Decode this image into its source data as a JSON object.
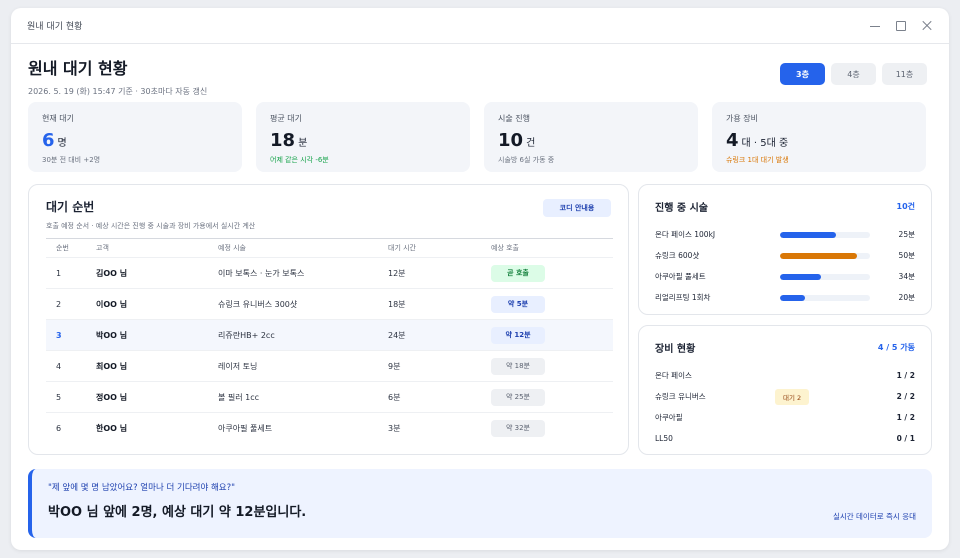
{
  "window": {
    "title": "원내 대기 현황"
  },
  "header": {
    "title": "원내 대기 현황",
    "subtitle": "2026. 5. 19 (화) 15:47 기준 · 30초마다 자동 갱신"
  },
  "floors": [
    {
      "label": "3층",
      "active": true
    },
    {
      "label": "4층",
      "active": false
    },
    {
      "label": "11층",
      "active": false
    }
  ],
  "stats": [
    {
      "label": "현재 대기",
      "value": "6",
      "unit": "명",
      "note": "30분 전 대비 +2명",
      "accent": "blue",
      "note_color": "gray"
    },
    {
      "label": "평균 대기",
      "value": "18",
      "unit": "분",
      "note": "어제 같은 시각 -6분",
      "accent": "dark",
      "note_color": "green"
    },
    {
      "label": "시술 진행",
      "value": "10",
      "unit": "건",
      "note": "시술방 6실 가동 중",
      "accent": "dark",
      "note_color": "gray"
    },
    {
      "label": "가용 장비",
      "value": "4",
      "unit": "대 · 5대 중",
      "note": "슈링크 1대 대기 발생",
      "accent": "dark",
      "note_color": "orange"
    }
  ],
  "queue": {
    "title": "대기 순번",
    "description": "호출 예정 순서 · 예상 시간은 진행 중 시술과 장비 가용에서 실시간 계산",
    "coord_button": "코디 안내용",
    "columns": [
      "순번",
      "고객",
      "예정 시술",
      "대기 시간",
      "예상 호출"
    ],
    "rows": [
      {
        "no": "1",
        "name": "김OO 님",
        "procedure": "이마 보톡스 · 눈가 보톡스",
        "wait": "12분",
        "call": "곧 호출",
        "style": "green",
        "highlight": false
      },
      {
        "no": "2",
        "name": "이OO 님",
        "procedure": "슈링크 유니버스 300샷",
        "wait": "18분",
        "call": "약 5분",
        "style": "blue",
        "highlight": false
      },
      {
        "no": "3",
        "name": "박OO 님",
        "procedure": "리쥬란HB+ 2cc",
        "wait": "24분",
        "call": "약 12분",
        "style": "blue",
        "highlight": true
      },
      {
        "no": "4",
        "name": "최OO 님",
        "procedure": "레이저 토닝",
        "wait": "9분",
        "call": "약 18분",
        "style": "gray",
        "highlight": false
      },
      {
        "no": "5",
        "name": "정OO 님",
        "procedure": "볼 필러 1cc",
        "wait": "6분",
        "call": "약 25분",
        "style": "gray",
        "highlight": false
      },
      {
        "no": "6",
        "name": "한OO 님",
        "procedure": "아쿠아필 풀세트",
        "wait": "3분",
        "call": "약 32분",
        "style": "gray",
        "highlight": false
      }
    ]
  },
  "in_progress": {
    "title": "진행 중 시술",
    "count": "10건",
    "items": [
      {
        "name": "온다 페이스 100kJ",
        "value": "25분",
        "progress": 0.62,
        "color": "blue"
      },
      {
        "name": "슈링크 600샷",
        "value": "50분",
        "progress": 0.85,
        "color": "orange"
      },
      {
        "name": "아쿠아필 풀세트",
        "value": "34분",
        "progress": 0.46,
        "color": "blue"
      },
      {
        "name": "리얼리프팅 1회차",
        "value": "20분",
        "progress": 0.28,
        "color": "blue"
      }
    ]
  },
  "equipment": {
    "title": "장비 현황",
    "count": "4 / 5 가동",
    "items": [
      {
        "name": "온다 페이스",
        "badge": "",
        "value": "1 / 2"
      },
      {
        "name": "슈링크 유니버스",
        "badge": "대기 2",
        "value": "2 / 2"
      },
      {
        "name": "아쿠아필",
        "badge": "",
        "value": "1 / 2"
      },
      {
        "name": "LL50",
        "badge": "",
        "value": "0 / 1"
      }
    ]
  },
  "banner": {
    "question": "\"제 앞에 몇 명 남았어요? 얼마나 더 기다려야 해요?\"",
    "answer": "박OO 님 앞에 2명, 예상 대기 약 12분입니다.",
    "link": "실시간 데이터로 즉시 응대"
  }
}
